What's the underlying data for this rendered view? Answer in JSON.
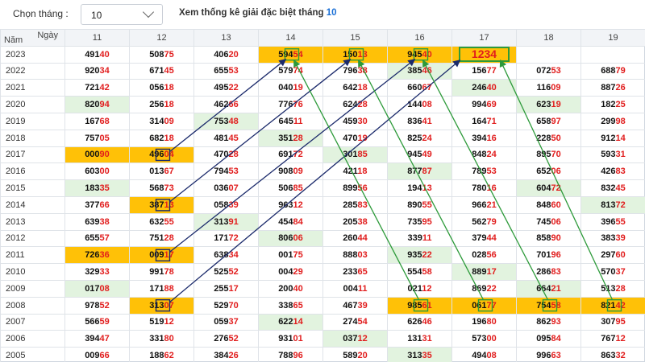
{
  "header": {
    "month_label": "Chọn tháng :",
    "month_value": "10",
    "stats_title": "Xem thống kê giải đặc biệt tháng",
    "stats_month": "10"
  },
  "table": {
    "corner_day": "Ngày",
    "corner_year": "Năm",
    "days": [
      "11",
      "12",
      "13",
      "14",
      "15",
      "16",
      "17",
      "18",
      "19"
    ],
    "rows": [
      {
        "year": "2023",
        "cells": [
          {
            "h": "491",
            "t": "40"
          },
          {
            "h": "508",
            "t": "75"
          },
          {
            "h": "406",
            "t": "20"
          },
          {
            "h": "594",
            "t": "54",
            "bg": "orange",
            "gb": true
          },
          {
            "h": "150",
            "t": "13",
            "bg": "orange",
            "gb": true
          },
          {
            "h": "945",
            "t": "40",
            "bg": "orange",
            "gb": true
          },
          {
            "big": "1234",
            "bg": "orange"
          },
          {
            "h": "",
            "t": ""
          },
          {
            "h": "",
            "t": ""
          }
        ]
      },
      {
        "year": "2022",
        "cells": [
          {
            "h": "920",
            "t": "34"
          },
          {
            "h": "671",
            "t": "45"
          },
          {
            "h": "655",
            "t": "53"
          },
          {
            "h": "579",
            "t": "74"
          },
          {
            "h": "796",
            "t": "38"
          },
          {
            "h": "385",
            "t": "46",
            "bg": "green"
          },
          {
            "h": "156",
            "t": "77"
          },
          {
            "h": "072",
            "t": "53"
          },
          {
            "h": "688",
            "t": "79"
          }
        ]
      },
      {
        "year": "2021",
        "cells": [
          {
            "h": "721",
            "t": "42"
          },
          {
            "h": "056",
            "t": "18"
          },
          {
            "h": "495",
            "t": "22"
          },
          {
            "h": "040",
            "t": "19"
          },
          {
            "h": "642",
            "t": "18"
          },
          {
            "h": "660",
            "t": "67"
          },
          {
            "h": "246",
            "t": "40",
            "bg": "green"
          },
          {
            "h": "116",
            "t": "09"
          },
          {
            "h": "887",
            "t": "26"
          }
        ]
      },
      {
        "year": "2020",
        "cells": [
          {
            "h": "820",
            "t": "94",
            "bg": "green"
          },
          {
            "h": "256",
            "t": "18"
          },
          {
            "h": "462",
            "t": "66"
          },
          {
            "h": "776",
            "t": "76"
          },
          {
            "h": "624",
            "t": "28"
          },
          {
            "h": "144",
            "t": "08"
          },
          {
            "h": "994",
            "t": "69"
          },
          {
            "h": "623",
            "t": "19",
            "bg": "green"
          },
          {
            "h": "182",
            "t": "25"
          }
        ]
      },
      {
        "year": "2019",
        "cells": [
          {
            "h": "167",
            "t": "68"
          },
          {
            "h": "314",
            "t": "09"
          },
          {
            "h": "753",
            "t": "48",
            "bg": "green"
          },
          {
            "h": "645",
            "t": "11"
          },
          {
            "h": "459",
            "t": "30"
          },
          {
            "h": "836",
            "t": "41"
          },
          {
            "h": "164",
            "t": "71"
          },
          {
            "h": "658",
            "t": "97"
          },
          {
            "h": "299",
            "t": "98"
          }
        ]
      },
      {
        "year": "2018",
        "cells": [
          {
            "h": "757",
            "t": "05"
          },
          {
            "h": "682",
            "t": "18"
          },
          {
            "h": "481",
            "t": "45"
          },
          {
            "h": "351",
            "t": "28",
            "bg": "green"
          },
          {
            "h": "470",
            "t": "19"
          },
          {
            "h": "825",
            "t": "24"
          },
          {
            "h": "394",
            "t": "16"
          },
          {
            "h": "228",
            "t": "50"
          },
          {
            "h": "912",
            "t": "14"
          }
        ]
      },
      {
        "year": "2017",
        "cells": [
          {
            "h": "000",
            "t": "90",
            "bg": "orange"
          },
          {
            "h": "496",
            "t": "04",
            "bg": "orange",
            "bb": true
          },
          {
            "h": "470",
            "t": "28"
          },
          {
            "h": "691",
            "t": "72"
          },
          {
            "h": "301",
            "t": "85",
            "bg": "green"
          },
          {
            "h": "945",
            "t": "49"
          },
          {
            "h": "848",
            "t": "24"
          },
          {
            "h": "895",
            "t": "70"
          },
          {
            "h": "593",
            "t": "31"
          }
        ]
      },
      {
        "year": "2016",
        "cells": [
          {
            "h": "603",
            "t": "00"
          },
          {
            "h": "013",
            "t": "67"
          },
          {
            "h": "794",
            "t": "53"
          },
          {
            "h": "908",
            "t": "09"
          },
          {
            "h": "421",
            "t": "18"
          },
          {
            "h": "877",
            "t": "87",
            "bg": "green"
          },
          {
            "h": "789",
            "t": "53"
          },
          {
            "h": "652",
            "t": "06"
          },
          {
            "h": "426",
            "t": "83"
          }
        ]
      },
      {
        "year": "2015",
        "cells": [
          {
            "h": "183",
            "t": "35",
            "bg": "green"
          },
          {
            "h": "568",
            "t": "73"
          },
          {
            "h": "036",
            "t": "07"
          },
          {
            "h": "506",
            "t": "85"
          },
          {
            "h": "899",
            "t": "56"
          },
          {
            "h": "194",
            "t": "13"
          },
          {
            "h": "780",
            "t": "16"
          },
          {
            "h": "604",
            "t": "72",
            "bg": "green"
          },
          {
            "h": "832",
            "t": "45"
          }
        ]
      },
      {
        "year": "2014",
        "cells": [
          {
            "h": "377",
            "t": "66"
          },
          {
            "h": "387",
            "t": "13",
            "bg": "orange",
            "bb": true
          },
          {
            "h": "058",
            "t": "39"
          },
          {
            "h": "963",
            "t": "12"
          },
          {
            "h": "285",
            "t": "83"
          },
          {
            "h": "890",
            "t": "55"
          },
          {
            "h": "966",
            "t": "21"
          },
          {
            "h": "848",
            "t": "60"
          },
          {
            "h": "813",
            "t": "72",
            "bg": "green"
          }
        ]
      },
      {
        "year": "2013",
        "cells": [
          {
            "h": "639",
            "t": "38"
          },
          {
            "h": "632",
            "t": "55"
          },
          {
            "h": "313",
            "t": "91",
            "bg": "green"
          },
          {
            "h": "454",
            "t": "84"
          },
          {
            "h": "205",
            "t": "38"
          },
          {
            "h": "735",
            "t": "95"
          },
          {
            "h": "562",
            "t": "79"
          },
          {
            "h": "745",
            "t": "06"
          },
          {
            "h": "396",
            "t": "55"
          }
        ]
      },
      {
        "year": "2012",
        "cells": [
          {
            "h": "655",
            "t": "57"
          },
          {
            "h": "751",
            "t": "28"
          },
          {
            "h": "171",
            "t": "72"
          },
          {
            "h": "806",
            "t": "06",
            "bg": "green"
          },
          {
            "h": "260",
            "t": "44"
          },
          {
            "h": "339",
            "t": "11"
          },
          {
            "h": "379",
            "t": "44"
          },
          {
            "h": "858",
            "t": "90"
          },
          {
            "h": "383",
            "t": "39"
          }
        ]
      },
      {
        "year": "2011",
        "cells": [
          {
            "h": "726",
            "t": "36",
            "bg": "orange"
          },
          {
            "h": "009",
            "t": "17",
            "bg": "orange",
            "bb": true
          },
          {
            "h": "638",
            "t": "34"
          },
          {
            "h": "001",
            "t": "75"
          },
          {
            "h": "888",
            "t": "03"
          },
          {
            "h": "935",
            "t": "22",
            "bg": "green"
          },
          {
            "h": "028",
            "t": "56"
          },
          {
            "h": "701",
            "t": "96"
          },
          {
            "h": "297",
            "t": "60"
          }
        ]
      },
      {
        "year": "2010",
        "cells": [
          {
            "h": "329",
            "t": "33"
          },
          {
            "h": "991",
            "t": "78"
          },
          {
            "h": "525",
            "t": "52"
          },
          {
            "h": "004",
            "t": "29"
          },
          {
            "h": "233",
            "t": "65"
          },
          {
            "h": "554",
            "t": "58"
          },
          {
            "h": "889",
            "t": "17",
            "bg": "green"
          },
          {
            "h": "286",
            "t": "83"
          },
          {
            "h": "570",
            "t": "37"
          }
        ]
      },
      {
        "year": "2009",
        "cells": [
          {
            "h": "017",
            "t": "08",
            "bg": "green"
          },
          {
            "h": "171",
            "t": "88"
          },
          {
            "h": "255",
            "t": "17"
          },
          {
            "h": "200",
            "t": "40"
          },
          {
            "h": "004",
            "t": "11"
          },
          {
            "h": "021",
            "t": "12"
          },
          {
            "h": "869",
            "t": "22"
          },
          {
            "h": "664",
            "t": "21",
            "bg": "green"
          },
          {
            "h": "513",
            "t": "28"
          }
        ]
      },
      {
        "year": "2008",
        "cells": [
          {
            "h": "978",
            "t": "52"
          },
          {
            "h": "313",
            "t": "07",
            "bg": "orange",
            "bb": true
          },
          {
            "h": "529",
            "t": "70"
          },
          {
            "h": "338",
            "t": "65"
          },
          {
            "h": "467",
            "t": "39"
          },
          {
            "h": "985",
            "t": "61",
            "bg": "orange",
            "gb": true
          },
          {
            "h": "061",
            "t": "77",
            "bg": "orange",
            "gb": true
          },
          {
            "h": "754",
            "t": "58",
            "bg": "orange",
            "gb": true
          },
          {
            "h": "821",
            "t": "42",
            "bg": "orange",
            "gb": true
          }
        ]
      },
      {
        "year": "2007",
        "cells": [
          {
            "h": "566",
            "t": "59"
          },
          {
            "h": "519",
            "t": "12"
          },
          {
            "h": "059",
            "t": "37"
          },
          {
            "h": "622",
            "t": "14",
            "bg": "green"
          },
          {
            "h": "274",
            "t": "54"
          },
          {
            "h": "626",
            "t": "46"
          },
          {
            "h": "196",
            "t": "80"
          },
          {
            "h": "862",
            "t": "93"
          },
          {
            "h": "307",
            "t": "95"
          }
        ]
      },
      {
        "year": "2006",
        "cells": [
          {
            "h": "394",
            "t": "47"
          },
          {
            "h": "331",
            "t": "80"
          },
          {
            "h": "276",
            "t": "52"
          },
          {
            "h": "931",
            "t": "01"
          },
          {
            "h": "037",
            "t": "12",
            "bg": "green"
          },
          {
            "h": "131",
            "t": "31"
          },
          {
            "h": "573",
            "t": "00"
          },
          {
            "h": "095",
            "t": "84"
          },
          {
            "h": "767",
            "t": "12"
          }
        ]
      },
      {
        "year": "2005",
        "cells": [
          {
            "h": "009",
            "t": "66"
          },
          {
            "h": "188",
            "t": "62"
          },
          {
            "h": "384",
            "t": "26"
          },
          {
            "h": "788",
            "t": "96"
          },
          {
            "h": "589",
            "t": "20"
          },
          {
            "h": "313",
            "t": "35",
            "bg": "green"
          },
          {
            "h": "494",
            "t": "08"
          },
          {
            "h": "996",
            "t": "63"
          },
          {
            "h": "863",
            "t": "32"
          }
        ]
      }
    ]
  },
  "colors": {
    "highlight_orange": "#ffc107",
    "highlight_green": "#e2f3df",
    "tail_red": "#e11d1d",
    "arrow_navy": "#1b2a6b",
    "arrow_green": "#2d9a3a",
    "month_accent": "#1a6fd6"
  }
}
